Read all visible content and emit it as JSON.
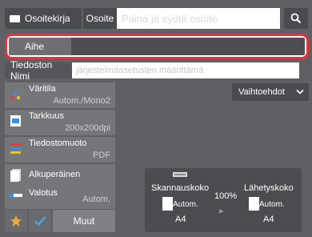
{
  "topbar": {
    "contacts_tab": "Osoitekirja",
    "address_tab": "Osoite",
    "address_placeholder": "Paina ja syötä osoite"
  },
  "subject": {
    "label": "Aihe"
  },
  "filename": {
    "label": "Tiedoston Nimi",
    "placeholder": "järjestelmäasetusten määrittämä"
  },
  "options_label": "Vaihtoehdot",
  "settings": [
    {
      "label": "Väritila",
      "value": "Autom./Mono2"
    },
    {
      "label": "Tarkkuus",
      "value": "200x200dpi"
    },
    {
      "label": "Tiedostomuoto",
      "value": "PDF"
    },
    {
      "label": "Alkuperäinen",
      "value": ""
    },
    {
      "label": "Valotus",
      "value": "Autom."
    }
  ],
  "preview": {
    "scan_size_label": "Skannauskoko",
    "send_size_label": "Lähetyskoko",
    "ratio": "100%",
    "scan_auto": "Autom.",
    "send_auto": "Autom.",
    "scan_paper": "A4",
    "send_paper": "A4"
  },
  "bottom": {
    "more_label": "Muut"
  },
  "colors": {
    "accent": "#e8333b",
    "panel": "#757679",
    "background": "#5f6064"
  }
}
